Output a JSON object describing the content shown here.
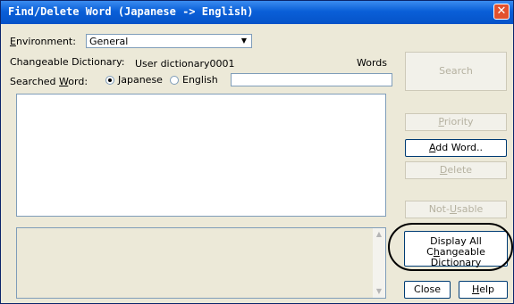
{
  "window": {
    "title": "Find/Delete Word (Japanese -> English)",
    "close_glyph": "✕"
  },
  "environment": {
    "label_u": "E",
    "label_rest": "nvironment:",
    "value": "General"
  },
  "changeable": {
    "label": "Changeable Dictionary:",
    "value": "User dictionary0001",
    "words_label": "Words"
  },
  "searched": {
    "label_pre": "Searched ",
    "label_u": "W",
    "label_post": "ord:",
    "options": [
      "Japanese",
      "English"
    ],
    "selected": "Japanese",
    "value": ""
  },
  "buttons": {
    "search": "Search",
    "priority_u": "P",
    "priority_rest": "riority",
    "add_u": "A",
    "add_rest": "dd Word..",
    "delete_u": "D",
    "delete_rest": "elete",
    "notusable_pre": "Not-",
    "notusable_u": "U",
    "notusable_rest": "sable",
    "display_line1": "Display All",
    "display_u": "h",
    "display_pre": "C",
    "display_rest": "angeable Dictionary",
    "close": "Close",
    "help_u": "H",
    "help_rest": "elp"
  },
  "icons": {
    "dropdown": "▼",
    "scroll_up": "▲",
    "scroll_down": "▼"
  }
}
